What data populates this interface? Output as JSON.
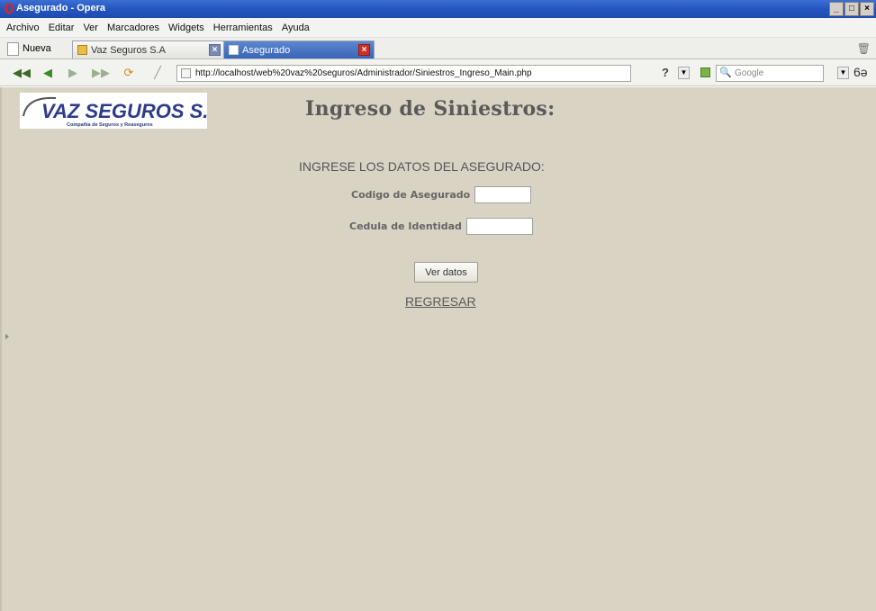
{
  "window": {
    "title": "Asegurado - Opera",
    "controls": [
      "_",
      "□",
      "×"
    ]
  },
  "menu": [
    "Archivo",
    "Editar",
    "Ver",
    "Marcadores",
    "Widgets",
    "Herramientas",
    "Ayuda"
  ],
  "tabs": {
    "new_label": "Nueva",
    "items": [
      {
        "label": "Vaz Seguros S.A",
        "active": false
      },
      {
        "label": "Asegurado",
        "active": true
      }
    ]
  },
  "address": {
    "url": "http://localhost/web%20vaz%20seguros/Administrador/Siniestros_Ingreso_Main.php",
    "search_placeholder": "Google"
  },
  "page": {
    "logo_text": "VAZ SEGUROS S.A.",
    "logo_subtext": "Compañía de Seguros y Reaseguros",
    "title": "Ingreso de Siniestros:",
    "prompt": "INGRESE LOS DATOS DEL ASEGURADO:",
    "fields": [
      {
        "label": "Codigo de Asegurado",
        "value": ""
      },
      {
        "label": "Cedula de Identidad",
        "value": ""
      }
    ],
    "submit_label": "Ver datos",
    "back_link": "REGRESAR"
  },
  "colors": {
    "content_bg": "#d9d3c4",
    "titlebar": "#2456c0",
    "active_tab": "#3865b8"
  }
}
